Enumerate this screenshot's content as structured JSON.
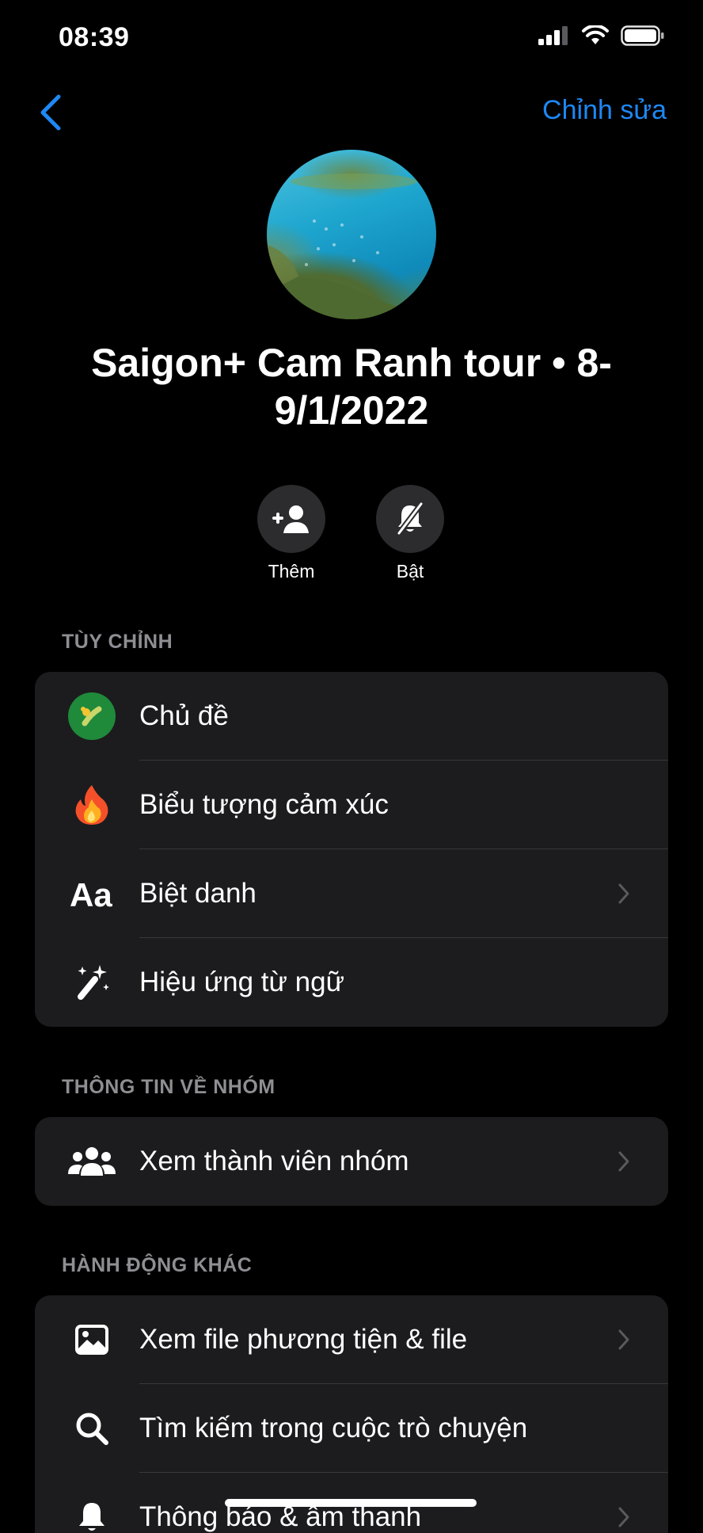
{
  "status_bar": {
    "time": "08:39"
  },
  "nav": {
    "edit_label": "Chỉnh sửa"
  },
  "group": {
    "title": "Saigon+ Cam Ranh tour • 8-9/1/2022"
  },
  "actions": [
    {
      "label": "Thêm",
      "icon": "add-person-icon"
    },
    {
      "label": "Bật",
      "icon": "bell-slash-icon"
    }
  ],
  "sections": {
    "customize": {
      "header": "TÙY CHỈNH",
      "items": [
        {
          "label": "Chủ đề",
          "icon": "theme-icon"
        },
        {
          "label": "Biểu tượng cảm xúc",
          "icon": "fire-emoji-icon"
        },
        {
          "label": "Biệt danh",
          "icon": "text-aa-icon"
        },
        {
          "label": "Hiệu ứng từ ngữ",
          "icon": "magic-wand-icon"
        }
      ]
    },
    "group_info": {
      "header": "THÔNG TIN VỀ NHÓM",
      "items": [
        {
          "label": "Xem thành viên nhóm",
          "icon": "people-icon"
        }
      ]
    },
    "other_actions": {
      "header": "HÀNH ĐỘNG KHÁC",
      "items": [
        {
          "label": "Xem file phương tiện & file",
          "icon": "photo-icon"
        },
        {
          "label": "Tìm kiếm trong cuộc trò chuyện",
          "icon": "search-icon"
        },
        {
          "label": "Thông báo & âm thanh",
          "icon": "bell-icon"
        }
      ]
    }
  },
  "colors": {
    "accent": "#1e88f5",
    "background": "#000000",
    "card": "#1c1c1e",
    "theme_green": "#1f8a3a"
  }
}
